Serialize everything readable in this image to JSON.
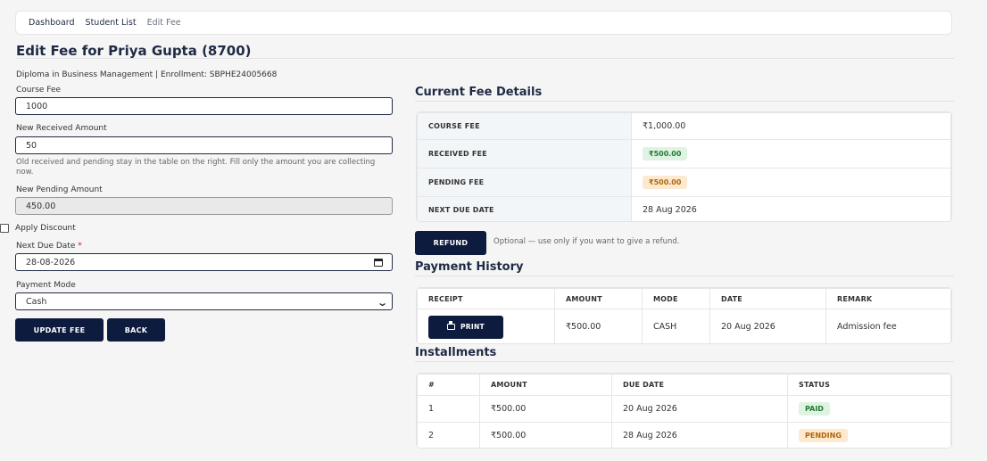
{
  "breadcrumb": {
    "items": [
      "Dashboard",
      "Student List",
      "Edit Fee"
    ]
  },
  "page": {
    "title": "Edit Fee for Priya Gupta (8700)",
    "meta": "Diploma in Business Management | Enrollment: SBPHE24005668"
  },
  "form": {
    "course_fee": {
      "label": "Course Fee",
      "value": "1000"
    },
    "new_received": {
      "label": "New Received Amount",
      "value": "50",
      "hint": "Old received and pending stay in the table on the right. Fill only the amount you are collecting now."
    },
    "new_pending": {
      "label": "New Pending Amount",
      "value": "450.00"
    },
    "discount": {
      "label": "Apply Discount",
      "checked": false
    },
    "due_date": {
      "label": "Next Due Date",
      "required_mark": "*",
      "value": "28-08-2026"
    },
    "payment_mode": {
      "label": "Payment Mode",
      "value": "Cash"
    },
    "update_button": "UPDATE FEE",
    "back_button": "BACK"
  },
  "fee_details": {
    "title": "Current Fee Details",
    "rows": [
      {
        "label": "COURSE FEE",
        "value": "₹1,000.00"
      },
      {
        "label": "RECEIVED FEE",
        "value": "₹500.00"
      },
      {
        "label": "PENDING FEE",
        "value": "₹500.00"
      },
      {
        "label": "NEXT DUE DATE",
        "value": "28 Aug 2026"
      }
    ],
    "refund_button": "REFUND",
    "refund_note": "Optional — use only if you want to give a refund."
  },
  "payment_history": {
    "title": "Payment History",
    "headers": [
      "RECEIPT",
      "AMOUNT",
      "MODE",
      "DATE",
      "REMARK"
    ],
    "rows": [
      {
        "receipt_button": "PRINT",
        "amount": "₹500.00",
        "mode": "CASH",
        "date": "20 Aug 2026",
        "remark": "Admission fee"
      }
    ]
  },
  "installments": {
    "title": "Installments",
    "headers": [
      "#",
      "AMOUNT",
      "DUE DATE",
      "STATUS"
    ],
    "rows": [
      {
        "num": "1",
        "amount": "₹500.00",
        "due": "20 Aug 2026",
        "status": "PAID"
      },
      {
        "num": "2",
        "amount": "₹500.00",
        "due": "28 Aug 2026",
        "status": "PENDING"
      }
    ]
  },
  "colors": {
    "primary": "#0d1b3e",
    "paid_bg": "#dff3e2",
    "pending_bg": "#fde9cf"
  }
}
